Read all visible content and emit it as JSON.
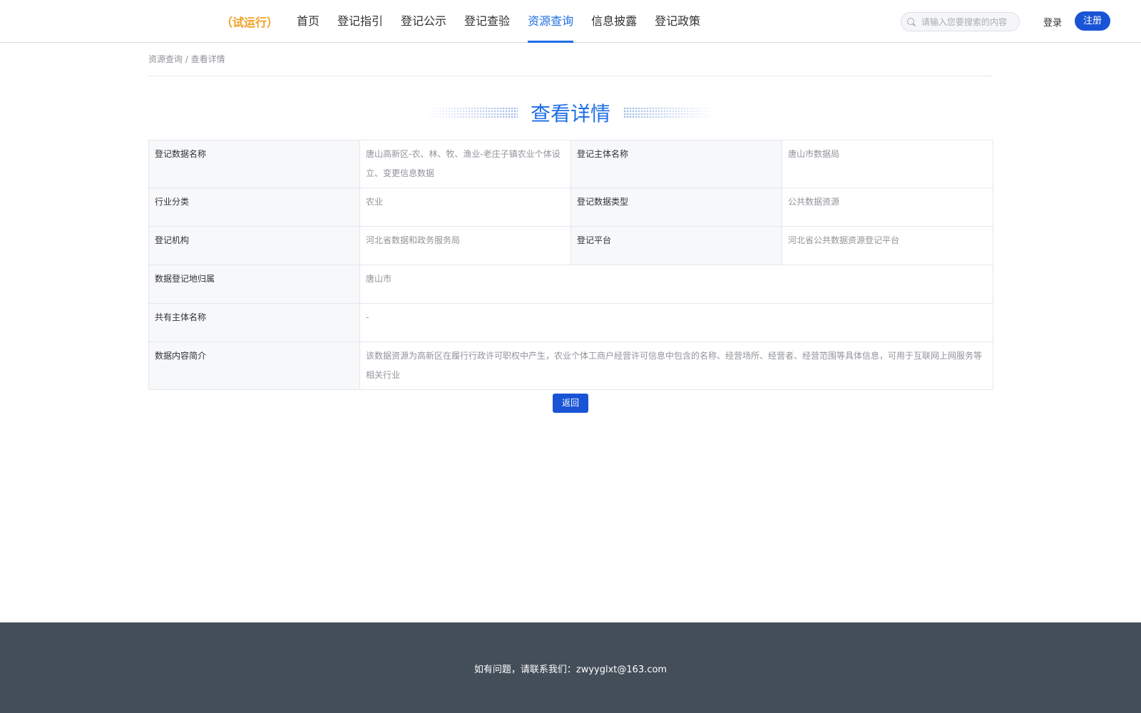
{
  "header": {
    "logo_suffix": "（试运行）",
    "nav": [
      {
        "label": "首页",
        "active": false
      },
      {
        "label": "登记指引",
        "active": false
      },
      {
        "label": "登记公示",
        "active": false
      },
      {
        "label": "登记查验",
        "active": false
      },
      {
        "label": "资源查询",
        "active": true
      },
      {
        "label": "信息披露",
        "active": false
      },
      {
        "label": "登记政策",
        "active": false
      }
    ],
    "search_placeholder": "请输入您要搜索的内容",
    "login_label": "登录",
    "register_label": "注册"
  },
  "breadcrumb": "资源查询 / 查看详情",
  "title": "查看详情",
  "details": {
    "name_label": "登记数据名称",
    "name_value": "唐山高新区-农、林、牧、渔业-老庄子镇农业个体设立、变更信息数据",
    "subject_label": "登记主体名称",
    "subject_value": "唐山市数据局",
    "industry_label": "行业分类",
    "industry_value": "农业",
    "type_label": "登记数据类型",
    "type_value": "公共数据资源",
    "org_label": "登记机构",
    "org_value": "河北省数据和政务服务局",
    "platform_label": "登记平台",
    "platform_value": "河北省公共数据资源登记平台",
    "location_label": "数据登记地归属",
    "location_value": "唐山市",
    "coowner_label": "共有主体名称",
    "coowner_value": "-",
    "summary_label": "数据内容简介",
    "summary_value": "该数据资源为高新区在履行行政许可职权中产生，农业个体工商户经营许可信息中包含的名称、经营场所、经营者、经营范围等具体信息，可用于互联网上网服务等相关行业"
  },
  "back_label": "返回",
  "footer_text": "如有问题，请联系我们：zwyyglxt@163.com"
}
